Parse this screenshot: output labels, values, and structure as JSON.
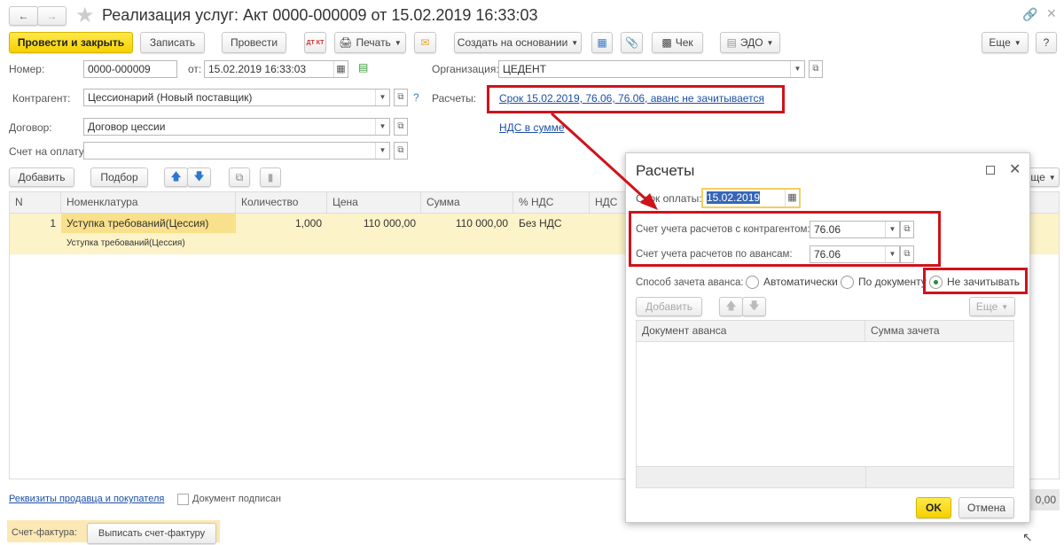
{
  "window": {
    "title": "Реализация услуг: Акт 0000-000009 от 15.02.2019 16:33:03"
  },
  "toolbar": {
    "post_close": "Провести и закрыть",
    "save": "Записать",
    "post": "Провести",
    "dtkt": "ДТ КТ",
    "print": "Печать",
    "create_based": "Создать на основании",
    "receipt": "Чек",
    "edo": "ЭДО",
    "more": "Еще",
    "help": "?"
  },
  "header": {
    "number_label": "Номер:",
    "number": "0000-000009",
    "date_label": "от:",
    "date": "15.02.2019 16:33:03",
    "org_label": "Организация:",
    "org": "ЦЕДЕНТ",
    "contractor_label": "Контрагент:",
    "contractor": "Цессионарий (Новый поставщик)",
    "help": "?",
    "settlements_label": "Расчеты:",
    "settlements_link": "Срок 15.02.2019, 76.06, 76.06, аванс не зачитывается",
    "contract_label": "Договор:",
    "contract": "Договор цессии",
    "vat_link": "НДС в сумме",
    "invoice_label": "Счет на оплату:",
    "invoice": ""
  },
  "table": {
    "add": "Добавить",
    "pick": "Подбор",
    "more": "Еще",
    "columns": [
      "N",
      "Номенклатура",
      "Количество",
      "Цена",
      "Сумма",
      "% НДС",
      "НДС"
    ],
    "rows": [
      {
        "n": "1",
        "item": "Уступка требований(Цессия)",
        "item_sub": "Уступка требований(Цессия)",
        "qty": "1,000",
        "price": "110 000,00",
        "sum": "110 000,00",
        "vat_rate": "Без НДС",
        "vat": ""
      }
    ],
    "total": "0,00"
  },
  "footer": {
    "requisites_link": "Реквизиты продавца и покупателя",
    "signed_label": "Документ подписан",
    "signed": false,
    "invoice_label": "Счет-фактура:",
    "invoice_button": "Выписать счет-фактуру"
  },
  "dialog": {
    "title": "Расчеты",
    "due_label": "Срок оплаты:",
    "due": "15.02.2019",
    "acc_contractor_label": "Счет учета расчетов с контрагентом:",
    "acc_contractor": "76.06",
    "acc_advance_label": "Счет учета расчетов по авансам:",
    "acc_advance": "76.06",
    "offset_label": "Способ зачета аванса:",
    "offset_options": [
      "Автоматически",
      "По документу",
      "Не зачитывать"
    ],
    "offset_selected": "Не зачитывать",
    "add": "Добавить",
    "more": "Еще",
    "columns": [
      "Документ аванса",
      "Сумма зачета"
    ],
    "ok": "OK",
    "cancel": "Отмена"
  },
  "colors": {
    "accent_yellow": "#f5d000",
    "highlight_red": "#d0121b",
    "link": "#1c4fa6",
    "row_selected": "#fdf3c8"
  }
}
